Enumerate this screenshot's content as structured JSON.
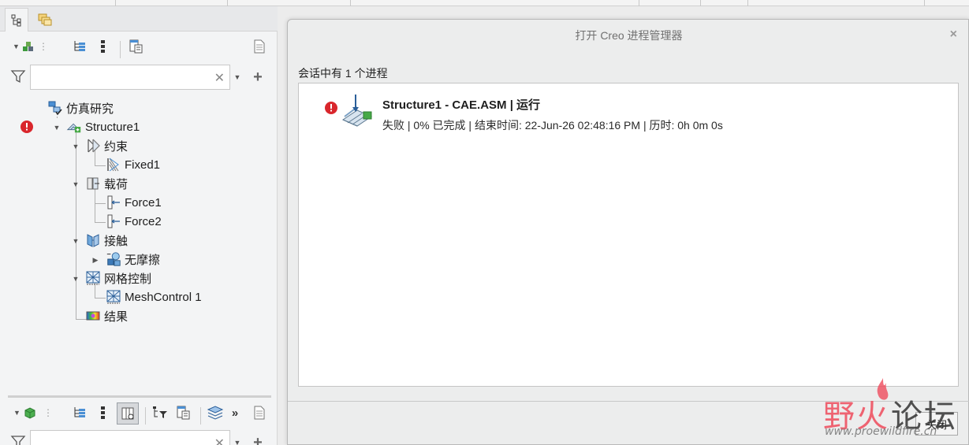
{
  "left_panel": {
    "search": {
      "value": "",
      "placeholder": ""
    },
    "bottom_search": {
      "value": "",
      "placeholder": ""
    },
    "more_label": "»",
    "tree": {
      "root": {
        "label": "仿真研究"
      },
      "study": {
        "label": "Structure1",
        "status": "error"
      },
      "constraints": {
        "label": "约束"
      },
      "fixed1": {
        "label": "Fixed1"
      },
      "loads": {
        "label": "载荷"
      },
      "force1": {
        "label": "Force1"
      },
      "force2": {
        "label": "Force2"
      },
      "contacts": {
        "label": "接触"
      },
      "frictionless": {
        "label": "无摩擦"
      },
      "mesh_control": {
        "label": "网格控制"
      },
      "mesh_control_1": {
        "label": "MeshControl 1"
      },
      "results": {
        "label": "结果"
      }
    }
  },
  "dialog": {
    "title": "打开 Creo 进程管理器",
    "close_glyph": "×",
    "subtitle": "会话中有 1 个进程",
    "process": {
      "title": "Structure1 - CAE.ASM | 运行",
      "detail": "失败 | 0% 已完成 | 结束时间: 22-Jun-26 02:48:16 PM | 历时: 0h 0m 0s",
      "status": "error"
    },
    "close_button": "关闭"
  },
  "watermark": {
    "main_part1": "野火",
    "main_part2": "论坛",
    "url": "www.proewildfire.cn"
  },
  "colors": {
    "error": "#d9262c",
    "accent_green": "#4caf50",
    "panel_bg": "#f3f4f5",
    "dialog_bg": "#eceded"
  }
}
